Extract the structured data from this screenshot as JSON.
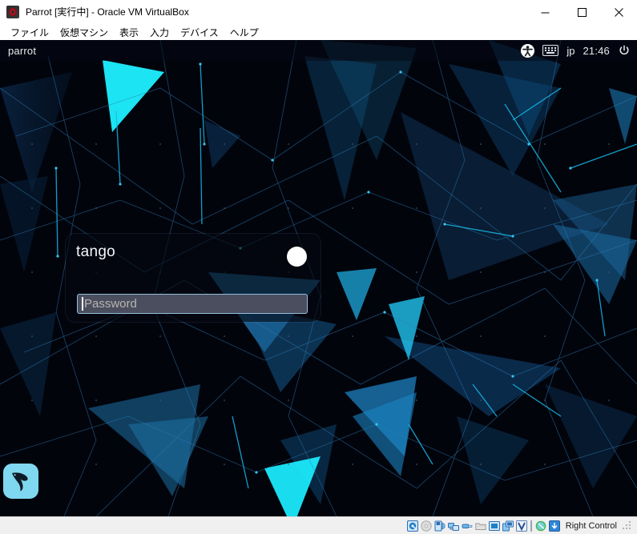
{
  "window": {
    "title": "Parrot [実行中] - Oracle VM VirtualBox",
    "icon_name": "virtualbox-icon",
    "buttons": {
      "minimize": "minimize-icon",
      "maximize": "maximize-icon",
      "close": "close-icon"
    }
  },
  "menubar": {
    "items": [
      {
        "label": "ファイル"
      },
      {
        "label": "仮想マシン"
      },
      {
        "label": "表示"
      },
      {
        "label": "入力"
      },
      {
        "label": "デバイス"
      },
      {
        "label": "ヘルプ"
      }
    ]
  },
  "greeter": {
    "topbar": {
      "hostname": "parrot",
      "accessibility_icon": "accessibility-icon",
      "keyboard_icon": "keyboard-icon",
      "language": "jp",
      "clock": "21:46",
      "power_icon": "power-icon"
    },
    "login": {
      "username": "tango",
      "avatar_name": "user-avatar",
      "password_placeholder": "Password",
      "password_value": ""
    },
    "logo_name": "parrot-os-logo"
  },
  "statusbar": {
    "icons": [
      {
        "name": "hard-disk-icon"
      },
      {
        "name": "optical-drive-icon"
      },
      {
        "name": "floppy-drive-icon"
      },
      {
        "name": "network-icon"
      },
      {
        "name": "usb-icon"
      },
      {
        "name": "shared-folder-icon"
      },
      {
        "name": "display-icon"
      },
      {
        "name": "recording-icon"
      },
      {
        "name": "virtualization-icon"
      },
      {
        "name": "mouse-integration-icon"
      },
      {
        "name": "keyboard-capture-icon"
      }
    ],
    "host_key_label": "Right Control"
  },
  "colors": {
    "accent_cyan": "#19e3f5",
    "wallpaper_blue": "#1f7fc0",
    "panel_bg": "rgba(5,8,16,0.62)",
    "input_bg": "#4a4e5f",
    "input_border": "#93bede",
    "statusbar_bg": "#f0f0f0"
  }
}
